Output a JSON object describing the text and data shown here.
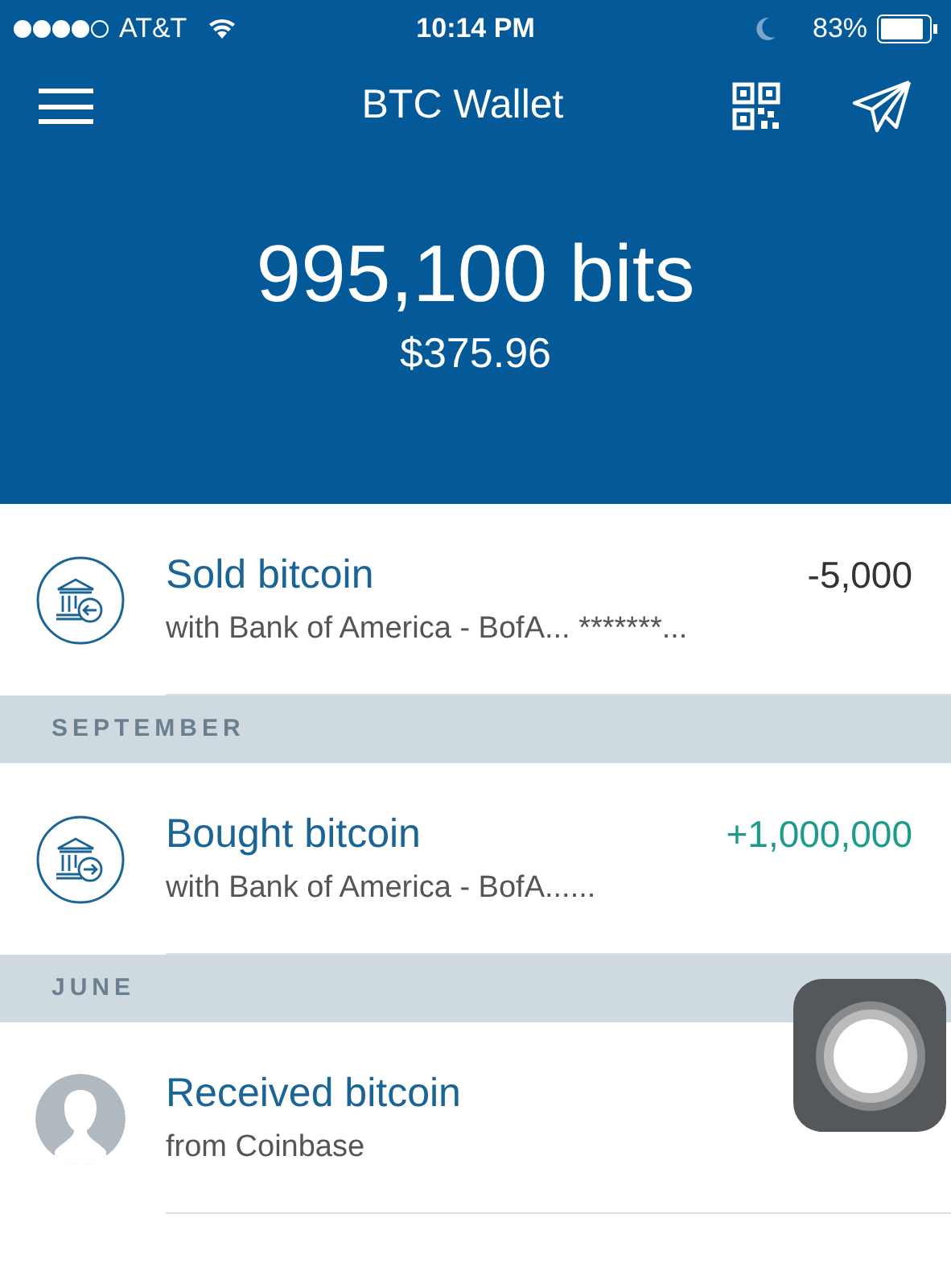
{
  "status_bar": {
    "carrier": "AT&T",
    "time": "10:14 PM",
    "battery": "83%"
  },
  "nav": {
    "title": "BTC Wallet"
  },
  "balance": {
    "amount": "995,100 bits",
    "fiat": "$375.96"
  },
  "feed": [
    {
      "kind": "sell",
      "title": "Sold bitcoin",
      "detail": "with Bank of America - BofA... *******...",
      "amount": "-5,000"
    },
    {
      "kind": "section",
      "label": "SEPTEMBER"
    },
    {
      "kind": "buy",
      "title": "Bought bitcoin",
      "detail": "with Bank of America - BofA......",
      "amount": "+1,000,000"
    },
    {
      "kind": "section",
      "label": "JUNE"
    },
    {
      "kind": "receive",
      "title": "Received bitcoin",
      "detail": "from Coinbase"
    }
  ]
}
